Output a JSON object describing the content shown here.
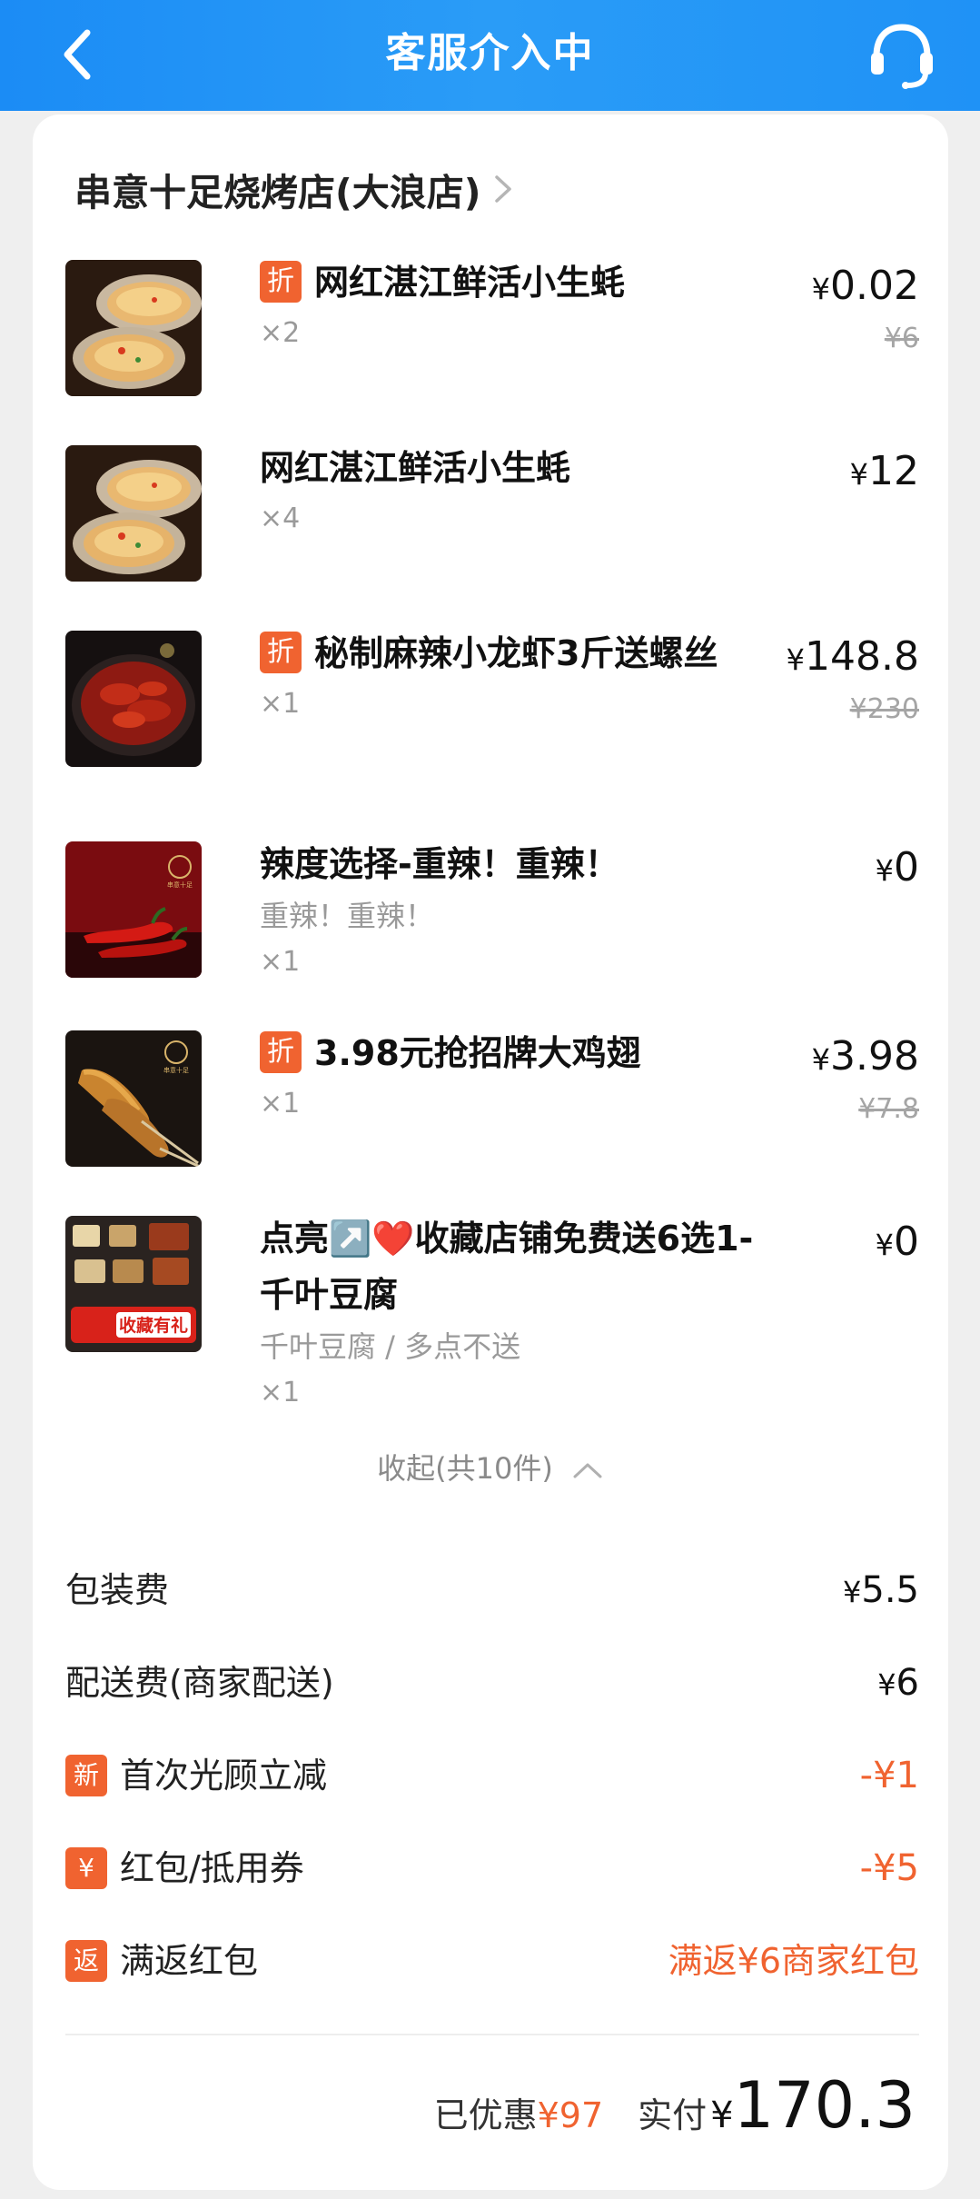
{
  "header": {
    "title": "客服介入中"
  },
  "store": {
    "name": "串意十足烧烤店(大浪店)"
  },
  "badges": {
    "discount": "折",
    "new": "新",
    "coupon": "¥",
    "rebate": "返"
  },
  "currency": "¥",
  "items": [
    {
      "name": "网红湛江鲜活小生蚝",
      "discounted": true,
      "qty": "×2",
      "price": "0.02",
      "original_price": "¥6",
      "spec": ""
    },
    {
      "name": "网红湛江鲜活小生蚝",
      "discounted": false,
      "qty": "×4",
      "price": "12",
      "original_price": "",
      "spec": ""
    },
    {
      "name": "秘制麻辣小龙虾3斤送螺丝",
      "discounted": true,
      "qty": "×1",
      "price": "148.8",
      "original_price": "¥230",
      "spec": ""
    },
    {
      "name": "辣度选择-重辣！重辣！",
      "discounted": false,
      "qty": "×1",
      "price": "0",
      "original_price": "",
      "spec": "重辣！重辣！"
    },
    {
      "name": "3.98元抢招牌大鸡翅",
      "discounted": true,
      "qty": "×1",
      "price": "3.98",
      "original_price": "¥7.8",
      "spec": ""
    },
    {
      "name": "点亮↗️❤️收藏店铺免费送6选1-千叶豆腐",
      "discounted": false,
      "qty": "×1",
      "price": "0",
      "original_price": "",
      "spec": "千叶豆腐 / 多点不送"
    }
  ],
  "thumbs": {
    "brand_text": "串意十足",
    "gift_text": "收藏有礼"
  },
  "collapse": {
    "label": "收起(共10件)"
  },
  "fees": {
    "packaging": {
      "label": "包装费",
      "value": "5.5"
    },
    "delivery": {
      "label": "配送费(商家配送)",
      "value": "6"
    },
    "first_visit": {
      "label": "首次光顾立减",
      "value": "-¥1"
    },
    "red_packet": {
      "label": "红包/抵用券",
      "value": "-¥5"
    },
    "rebate": {
      "label": "满返红包",
      "value": "满返¥6商家红包"
    }
  },
  "summary": {
    "discount_label": "已优惠",
    "discount_value": "¥97",
    "paid_label": "实付",
    "paid_value": "170.3"
  },
  "colors": {
    "header_blue": "#1b8cf5",
    "accent_orange": "#f06330"
  }
}
